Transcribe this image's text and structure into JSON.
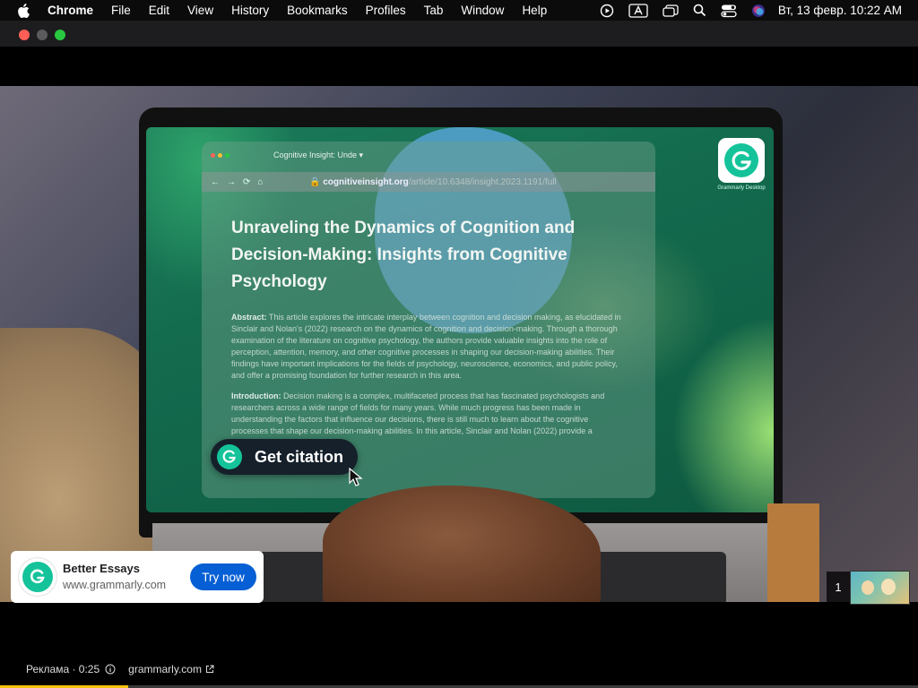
{
  "menubar": {
    "app_name": "Chrome",
    "items": [
      "File",
      "Edit",
      "View",
      "History",
      "Bookmarks",
      "Profiles",
      "Tab",
      "Window",
      "Help"
    ],
    "clock": "Вт, 13 февр.  10:22 AM",
    "status_icons": [
      "play-circle-icon",
      "keyboard-input-icon",
      "window-icon",
      "search-icon",
      "control-center-icon",
      "siri-icon"
    ]
  },
  "video": {
    "browser_tab_title": "Cognitive Insight: Unde ▾",
    "url_domain": "cognitiveinsight.org",
    "url_path": "/article/10.6348/insight.2023.1191/full",
    "article_title": "Unraveling the Dynamics of Cognition and Decision-Making: Insights from Cognitive Psychology",
    "abstract_label": "Abstract:",
    "abstract_text": "This article explores the intricate interplay between cognition and decision making, as elucidated in Sinclair and Nolan's (2022) research on the dynamics of cognition and decision-making. Through a thorough examination of the literature on cognitive psychology, the authors provide valuable insights into the role of perception, attention, memory, and other cognitive processes in shaping our decision-making abilities. Their findings have important implications for the fields of psychology, neuroscience, economics, and public policy, and offer a promising foundation for further research in this area.",
    "intro_label": "Introduction:",
    "intro_text": "Decision making is a complex, multifaceted process that has fascinated psychologists and researchers across a wide range of fields for many years. While much progress has been made in understanding the factors that influence our decisions, there is still much to learn about the cognitive processes that shape our decision-making abilities. In this article, Sinclair and Nolan (2022) provide a comprehensive overview of the...",
    "citation_button": "Get citation",
    "grammarly_tile_label": "Grammarly Desktop"
  },
  "ad": {
    "title": "Better Essays",
    "url": "www.grammarly.com",
    "cta": "Try now",
    "counter": "1",
    "label": "Реклама · 0:25",
    "domain": "grammarly.com",
    "progress": 0.14
  },
  "colors": {
    "cta_blue": "#065fd4",
    "grammarly_green": "#15c39a",
    "progress_yellow": "#f4c20d"
  }
}
